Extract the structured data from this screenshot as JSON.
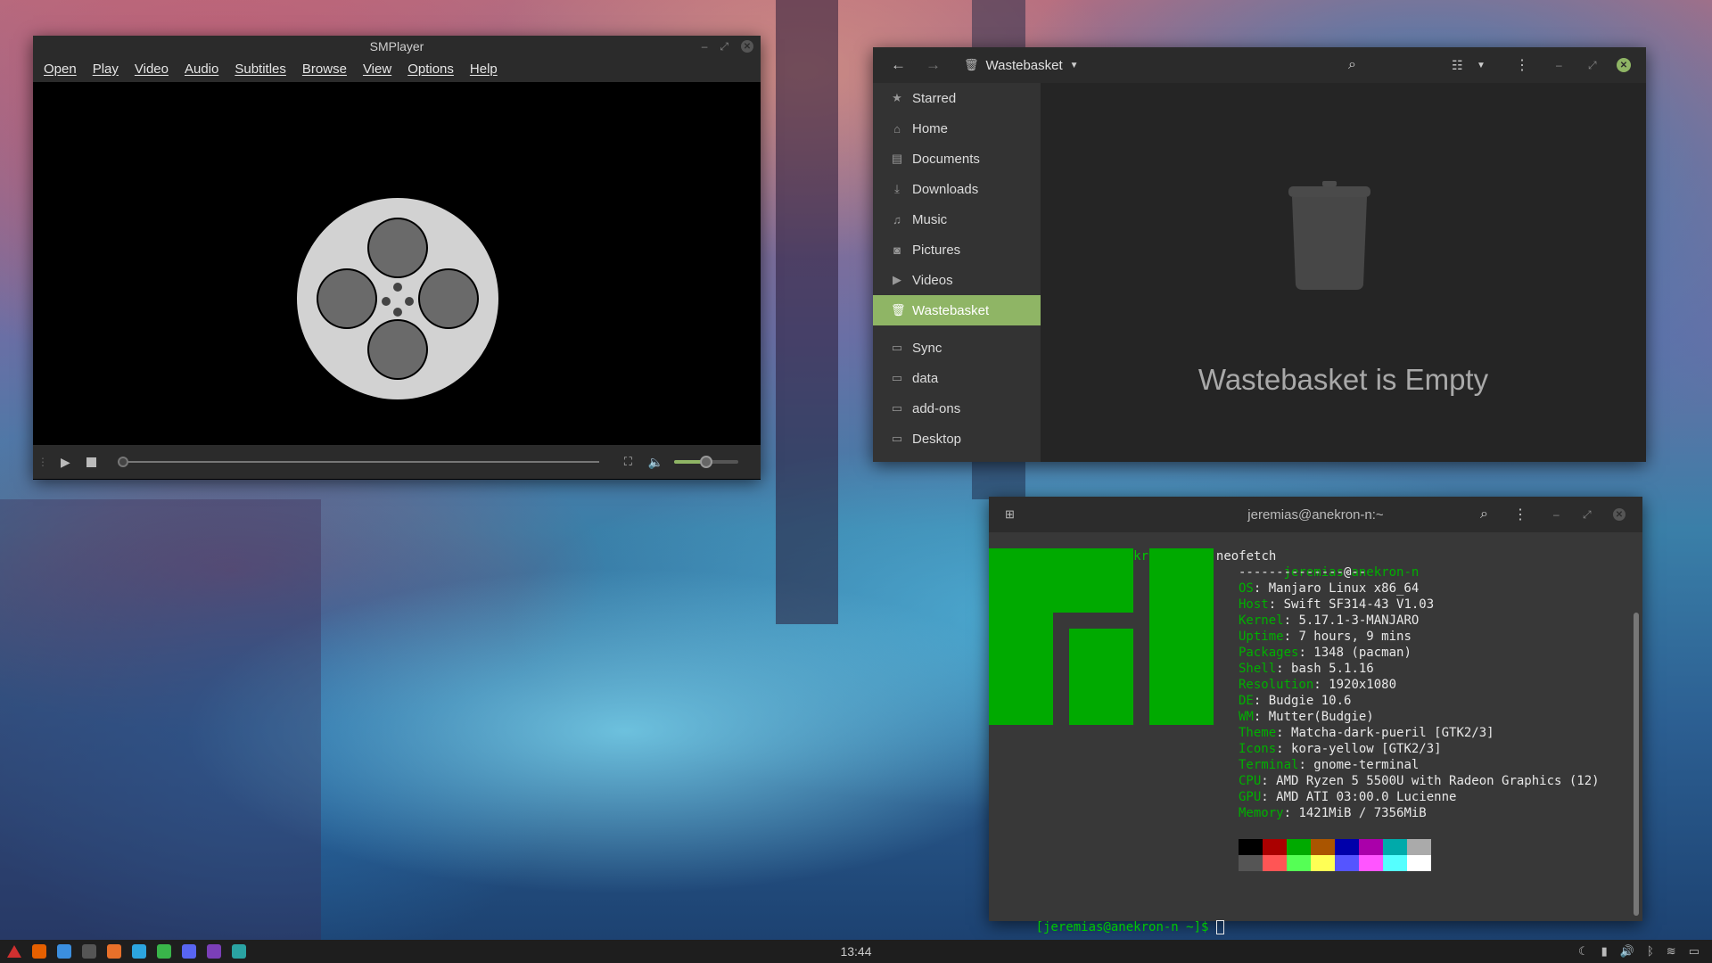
{
  "smplayer": {
    "title": "SMPlayer",
    "menu": [
      "Open",
      "Play",
      "Video",
      "Audio",
      "Subtitles",
      "Browse",
      "View",
      "Options",
      "Help"
    ],
    "volume_level": 0.5,
    "seek_position": 0.0
  },
  "files": {
    "location": "Wastebasket",
    "sidebar": [
      {
        "label": "Starred",
        "icon": "star-icon",
        "glyph": "★"
      },
      {
        "label": "Home",
        "icon": "home-icon",
        "glyph": "⌂"
      },
      {
        "label": "Documents",
        "icon": "documents-icon",
        "glyph": "▤"
      },
      {
        "label": "Downloads",
        "icon": "downloads-icon",
        "glyph": "⤓"
      },
      {
        "label": "Music",
        "icon": "music-icon",
        "glyph": "♫"
      },
      {
        "label": "Pictures",
        "icon": "pictures-icon",
        "glyph": "◙"
      },
      {
        "label": "Videos",
        "icon": "videos-icon",
        "glyph": "▶"
      },
      {
        "label": "Wastebasket",
        "icon": "trash-icon",
        "glyph": "🗑",
        "active": true
      }
    ],
    "bookmarks": [
      {
        "label": "Sync",
        "icon": "folder-icon",
        "glyph": "▭"
      },
      {
        "label": "data",
        "icon": "folder-icon",
        "glyph": "▭"
      },
      {
        "label": "add-ons",
        "icon": "folder-icon",
        "glyph": "▭"
      },
      {
        "label": "Desktop",
        "icon": "folder-icon",
        "glyph": "▭"
      }
    ],
    "empty_message": "Wastebasket is Empty",
    "accent": "#8fb565"
  },
  "terminal": {
    "title": "jeremias@anekron-n:~",
    "prompt": "[jeremias@anekron-n ~]$",
    "command": "neofetch",
    "user": "jeremias",
    "host": "anekron-n",
    "separator": "-----------------",
    "info": [
      {
        "key": "OS",
        "value": "Manjaro Linux x86_64"
      },
      {
        "key": "Host",
        "value": "Swift SF314-43 V1.03"
      },
      {
        "key": "Kernel",
        "value": "5.17.1-3-MANJARO"
      },
      {
        "key": "Uptime",
        "value": "7 hours, 9 mins"
      },
      {
        "key": "Packages",
        "value": "1348 (pacman)"
      },
      {
        "key": "Shell",
        "value": "bash 5.1.16"
      },
      {
        "key": "Resolution",
        "value": "1920x1080"
      },
      {
        "key": "DE",
        "value": "Budgie 10.6"
      },
      {
        "key": "WM",
        "value": "Mutter(Budgie)"
      },
      {
        "key": "Theme",
        "value": "Matcha-dark-pueril [GTK2/3]"
      },
      {
        "key": "Icons",
        "value": "kora-yellow [GTK2/3]"
      },
      {
        "key": "Terminal",
        "value": "gnome-terminal"
      },
      {
        "key": "CPU",
        "value": "AMD Ryzen 5 5500U with Radeon Graphics (12)"
      },
      {
        "key": "GPU",
        "value": "AMD ATI 03:00.0 Lucienne"
      },
      {
        "key": "Memory",
        "value": "1421MiB / 7356MiB"
      }
    ],
    "palette_top": [
      "#000000",
      "#aa0000",
      "#00aa00",
      "#aa5500",
      "#0000aa",
      "#aa00aa",
      "#00aaaa",
      "#aaaaaa"
    ],
    "palette_bottom": [
      "#555555",
      "#ff5555",
      "#55ff55",
      "#ffff55",
      "#5555ff",
      "#ff55ff",
      "#55ffff",
      "#ffffff"
    ]
  },
  "taskbar": {
    "clock": "13:44",
    "apps": [
      {
        "name": "app-menu-icon",
        "color": "#d03030"
      },
      {
        "name": "firefox-icon",
        "color": "#e66000"
      },
      {
        "name": "files-icon",
        "color": "#3b8fe0"
      },
      {
        "name": "terminal-icon",
        "color": "#555555"
      },
      {
        "name": "archive-icon",
        "color": "#e8702a"
      },
      {
        "name": "telegram-icon",
        "color": "#2ca5e0"
      },
      {
        "name": "sync-icon",
        "color": "#39b54a"
      },
      {
        "name": "discord-icon",
        "color": "#5865f2"
      },
      {
        "name": "podcast-icon",
        "color": "#7b3fb8"
      },
      {
        "name": "smplayer-icon",
        "color": "#2aa3a3"
      }
    ]
  }
}
